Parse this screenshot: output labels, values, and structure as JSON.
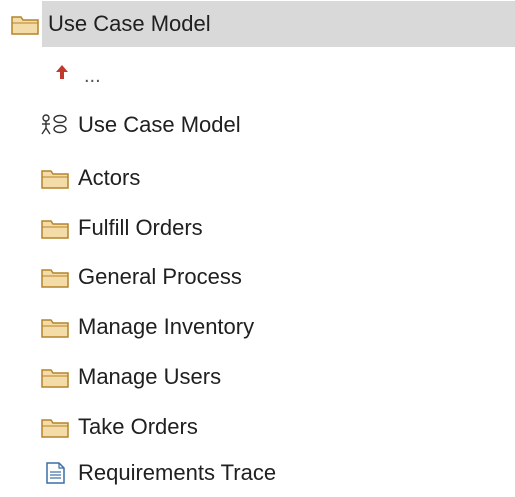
{
  "colors": {
    "folder_fill": "#f3dca8",
    "folder_stroke": "#b5832a",
    "up_arrow": "#c0392b",
    "selection": "#d9d9d9",
    "doc_stroke": "#3a6ea5"
  },
  "tree": {
    "root": {
      "label": "Use Case Model",
      "icon": "folder-icon",
      "selected": true
    },
    "up": {
      "label": "...",
      "icon": "up-arrow-icon"
    },
    "items": [
      {
        "label": "Use Case Model",
        "icon": "use-case-diagram-icon"
      },
      {
        "label": "Actors",
        "icon": "folder-icon"
      },
      {
        "label": "Fulfill Orders",
        "icon": "folder-icon"
      },
      {
        "label": "General Process",
        "icon": "folder-icon"
      },
      {
        "label": "Manage Inventory",
        "icon": "folder-icon"
      },
      {
        "label": "Manage Users",
        "icon": "folder-icon"
      },
      {
        "label": "Take Orders",
        "icon": "folder-icon"
      },
      {
        "label": "Requirements Trace",
        "icon": "document-icon"
      }
    ]
  }
}
